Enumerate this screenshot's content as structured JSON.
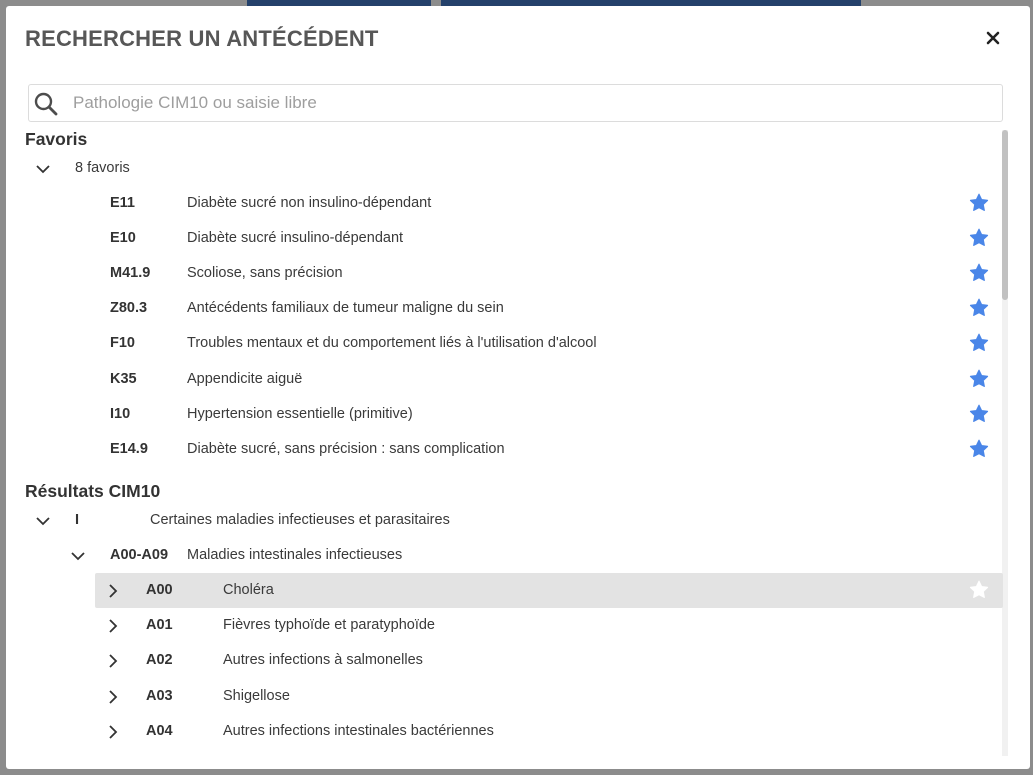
{
  "dialog": {
    "title": "RECHERCHER UN ANTÉCÉDENT",
    "close_icon": "close-icon"
  },
  "search": {
    "placeholder": "Pathologie CIM10 ou saisie libre",
    "value": "",
    "icon": "search-icon"
  },
  "favorites": {
    "section_title": "Favoris",
    "count_label": "8 favoris",
    "expanded": true,
    "items": [
      {
        "code": "E11",
        "label": "Diabète sucré non insulino-dépendant",
        "starred": true
      },
      {
        "code": "E10",
        "label": "Diabète sucré insulino-dépendant",
        "starred": true
      },
      {
        "code": "M41.9",
        "label": "Scoliose, sans précision",
        "starred": true
      },
      {
        "code": "Z80.3",
        "label": "Antécédents familiaux de tumeur maligne du sein",
        "starred": true
      },
      {
        "code": "F10",
        "label": "Troubles mentaux et du comportement liés à l'utilisation d'alcool",
        "starred": true
      },
      {
        "code": "K35",
        "label": "Appendicite aiguë",
        "starred": true
      },
      {
        "code": "I10",
        "label": "Hypertension essentielle (primitive)",
        "starred": true
      },
      {
        "code": "E14.9",
        "label": "Diabète sucré, sans précision : sans complication",
        "starred": true
      }
    ]
  },
  "results": {
    "section_title": "Résultats CIM10",
    "chapter": {
      "code": "I",
      "label": "Certaines maladies infectieuses et parasitaires",
      "expanded": true
    },
    "block": {
      "code": "A00-A09",
      "label": "Maladies intestinales infectieuses",
      "expanded": true
    },
    "items": [
      {
        "code": "A00",
        "label": "Choléra",
        "highlighted": true,
        "starred": false
      },
      {
        "code": "A01",
        "label": "Fièvres typhoïde et paratyphoïde",
        "highlighted": false
      },
      {
        "code": "A02",
        "label": "Autres infections à salmonelles",
        "highlighted": false
      },
      {
        "code": "A03",
        "label": "Shigellose",
        "highlighted": false
      },
      {
        "code": "A04",
        "label": "Autres infections intestinales bactériennes",
        "highlighted": false
      }
    ]
  },
  "colors": {
    "star_active": "#4a86e8",
    "star_inactive": "#ffffff",
    "highlight_row": "#e3e3e3",
    "title_text": "#575757"
  }
}
